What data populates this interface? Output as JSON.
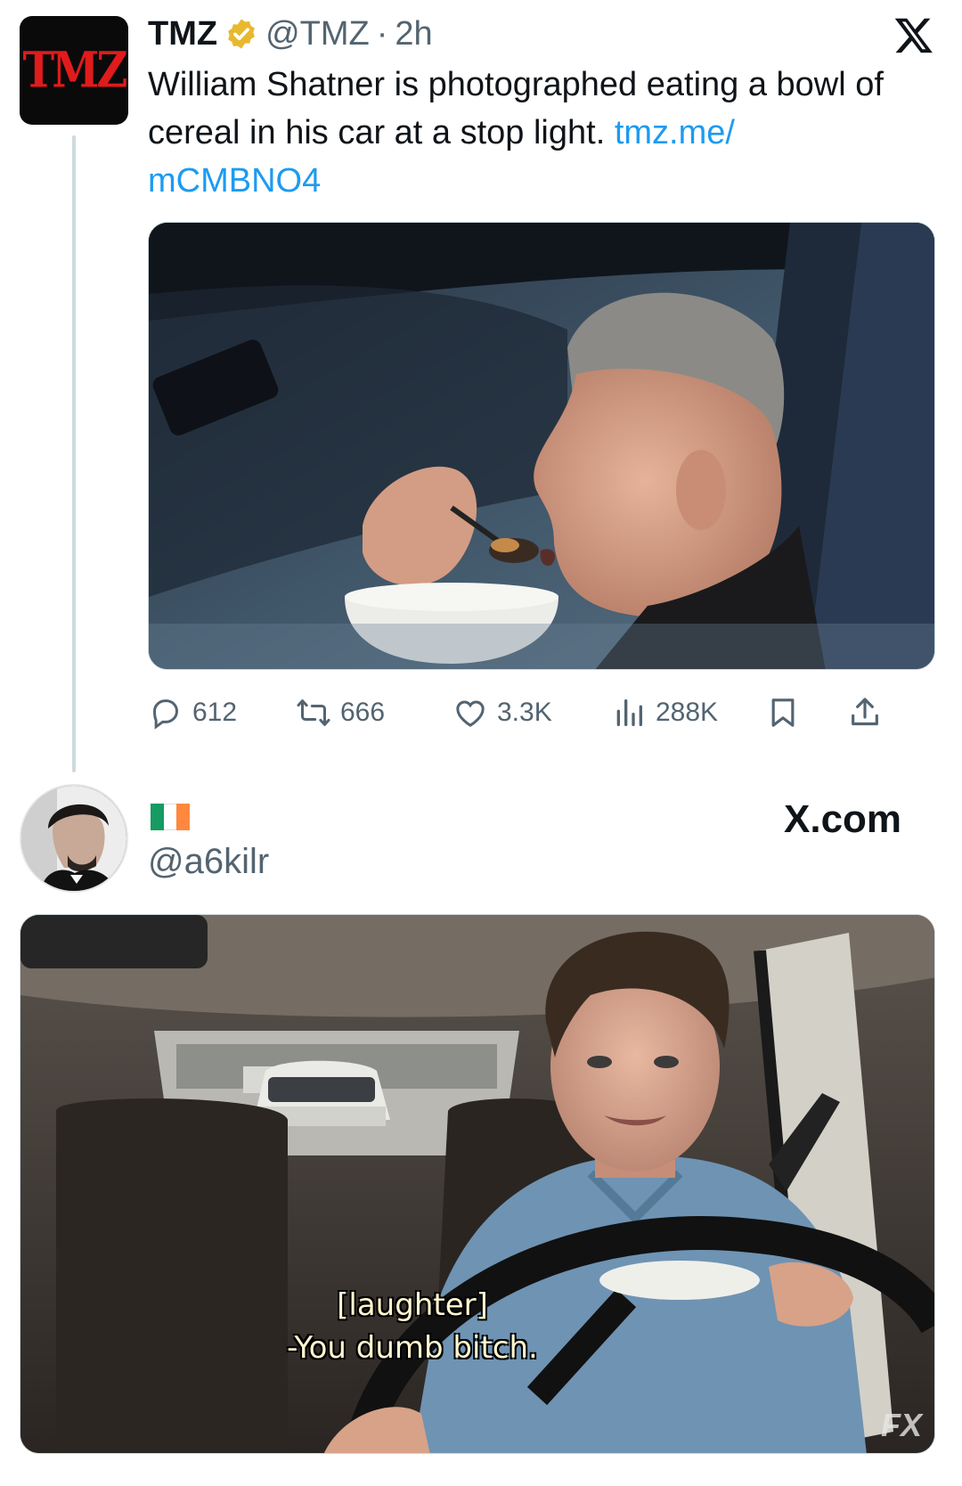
{
  "tweet": {
    "avatar_text": "TMZ",
    "display_name": "TMZ",
    "handle": "@TMZ",
    "separator": "·",
    "time": "2h",
    "verified": true,
    "text": "William Shatner is photographed eating a bowl of cereal in his car at a stop light.",
    "link_part1": "tmz.me/",
    "link_part2": "mCMBNO4",
    "stats": {
      "replies": "612",
      "reposts": "666",
      "likes": "3.3K",
      "views": "288K"
    },
    "icons": [
      "reply-icon",
      "repost-icon",
      "like-icon",
      "views-icon",
      "bookmark-icon",
      "share-icon",
      "x-logo-icon"
    ]
  },
  "reply": {
    "flag": "ireland-flag",
    "handle": "@a6kilr",
    "watermark": "X.com",
    "subtitle_line1": "[laughter]",
    "subtitle_line2": "-You dumb bitch.",
    "network_logo": "FX"
  },
  "colors": {
    "link": "#1d9bf0",
    "secondary_text": "#536471",
    "tmz_red": "#e01b1b",
    "verified_gold": "#e8b82e"
  }
}
